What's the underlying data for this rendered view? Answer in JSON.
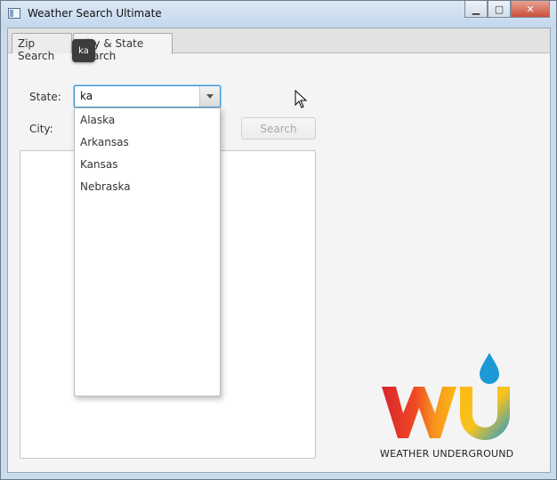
{
  "window": {
    "title": "Weather Search Ultimate",
    "minimize_icon": "minimize-icon",
    "maximize_icon": "maximize-icon",
    "close_icon": "close-icon"
  },
  "tabs": [
    {
      "label": "Zip Search"
    },
    {
      "label": "City & State Search"
    }
  ],
  "tooltip": {
    "text": "ka"
  },
  "form": {
    "state_label": "State:",
    "state_value": "ka",
    "city_label": "City:",
    "search_label": "Search"
  },
  "dropdown": {
    "options": [
      "Alaska",
      "Arkansas",
      "Kansas",
      "Nebraska"
    ]
  },
  "logo": {
    "text": "WEATHER UNDERGROUND",
    "colors": {
      "red": "#e2231a",
      "orange": "#f7931e",
      "yellow": "#fdb913",
      "blue": "#1b9ad6"
    }
  }
}
